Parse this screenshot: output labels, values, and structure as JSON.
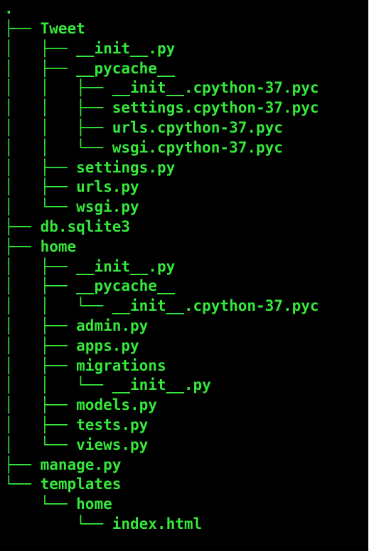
{
  "root": ".",
  "colors": {
    "background": "#000000",
    "text": "#35e83b"
  },
  "tree": [
    {
      "prefix": "├── ",
      "name": "Tweet"
    },
    {
      "prefix": "│   ├── ",
      "name": "__init__.py"
    },
    {
      "prefix": "│   ├── ",
      "name": "__pycache__"
    },
    {
      "prefix": "│   │   ├── ",
      "name": "__init__.cpython-37.pyc"
    },
    {
      "prefix": "│   │   ├── ",
      "name": "settings.cpython-37.pyc"
    },
    {
      "prefix": "│   │   ├── ",
      "name": "urls.cpython-37.pyc"
    },
    {
      "prefix": "│   │   └── ",
      "name": "wsgi.cpython-37.pyc"
    },
    {
      "prefix": "│   ├── ",
      "name": "settings.py"
    },
    {
      "prefix": "│   ├── ",
      "name": "urls.py"
    },
    {
      "prefix": "│   └── ",
      "name": "wsgi.py"
    },
    {
      "prefix": "├── ",
      "name": "db.sqlite3"
    },
    {
      "prefix": "├── ",
      "name": "home"
    },
    {
      "prefix": "│   ├── ",
      "name": "__init__.py"
    },
    {
      "prefix": "│   ├── ",
      "name": "__pycache__"
    },
    {
      "prefix": "│   │   └── ",
      "name": "__init__.cpython-37.pyc"
    },
    {
      "prefix": "│   ├── ",
      "name": "admin.py"
    },
    {
      "prefix": "│   ├── ",
      "name": "apps.py"
    },
    {
      "prefix": "│   ├── ",
      "name": "migrations"
    },
    {
      "prefix": "│   │   └── ",
      "name": "__init__.py"
    },
    {
      "prefix": "│   ├── ",
      "name": "models.py"
    },
    {
      "prefix": "│   ├── ",
      "name": "tests.py"
    },
    {
      "prefix": "│   └── ",
      "name": "views.py"
    },
    {
      "prefix": "├── ",
      "name": "manage.py"
    },
    {
      "prefix": "└── ",
      "name": "templates"
    },
    {
      "prefix": "    └── ",
      "name": "home"
    },
    {
      "prefix": "        └── ",
      "name": "index.html"
    }
  ]
}
